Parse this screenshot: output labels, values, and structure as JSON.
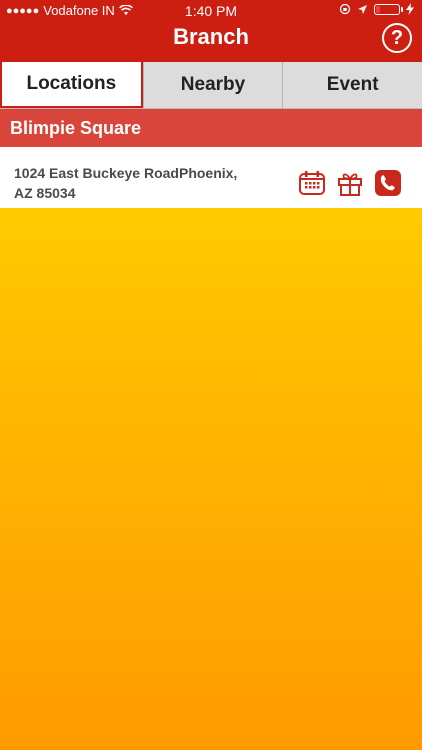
{
  "status": {
    "carrier": "Vodafone IN",
    "time": "1:40 PM"
  },
  "header": {
    "title": "Branch",
    "help_label": "?"
  },
  "tabs": [
    {
      "label": "Locations",
      "active": true
    },
    {
      "label": "Nearby",
      "active": false
    },
    {
      "label": "Event",
      "active": false
    }
  ],
  "section": {
    "title": "Blimpie Square"
  },
  "locations": [
    {
      "address_line1": "1024 East Buckeye RoadPhoenix,",
      "address_line2": "AZ 85034",
      "icons": [
        "calendar-icon",
        "gift-icon",
        "phone-icon"
      ]
    }
  ],
  "colors": {
    "header_red": "#cc1f12",
    "section_red": "#d9453a",
    "background_top": "#ffe100",
    "background_bottom": "#ff9a00"
  }
}
